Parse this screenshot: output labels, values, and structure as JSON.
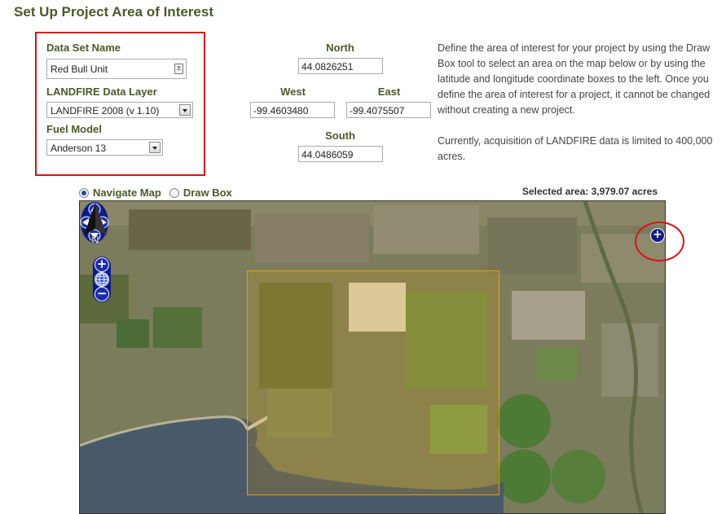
{
  "page": {
    "title": "Set Up Project Area of Interest"
  },
  "form": {
    "dataset_label": "Data Set Name",
    "dataset_value": "Red Bull Unit",
    "layer_label": "LANDFIRE Data Layer",
    "layer_value": "LANDFIRE 2008 (v 1.10)",
    "fuel_label": "Fuel Model",
    "fuel_value": "Anderson 13"
  },
  "coords": {
    "north_label": "North",
    "north_value": "44.0826251",
    "west_label": "West",
    "west_value": "-99.4603480",
    "east_label": "East",
    "east_value": "-99.4075507",
    "south_label": "South",
    "south_value": "44.0486059"
  },
  "description": {
    "para1": "Define the area of interest for your project by using the Draw Box tool to select an area on the map below or by using the latitude and longitude coordinate boxes to the left. Once you define the area of interest for a project, it cannot be changed without creating a new project.",
    "para2": "Currently, acquisition of LANDFIRE data is limited to 400,000 acres."
  },
  "map_mode": {
    "navigate_label": "Navigate Map",
    "draw_label": "Draw Box",
    "selected": "navigate"
  },
  "selected_area": "Selected area: 3,979.07 acres",
  "map": {
    "zoom_in": "+",
    "zoom_out": "−",
    "layer_switcher": "+",
    "north_letter": "N"
  },
  "colors": {
    "title": "#4a5a28",
    "highlight": "#e01010",
    "aoi_border": "#e8a100",
    "map_controls": "#0f1a8a"
  }
}
